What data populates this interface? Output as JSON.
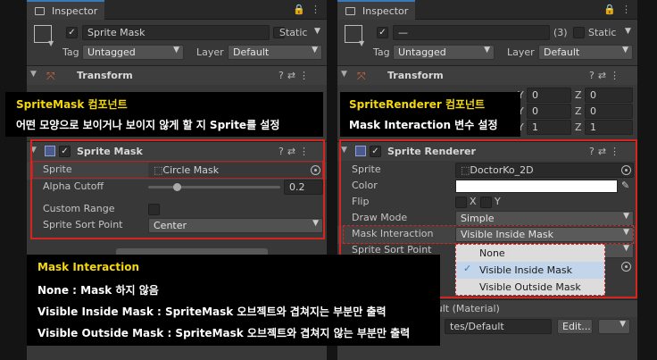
{
  "left": {
    "tab": "Inspector",
    "object_name": "Sprite Mask",
    "static_label": "Static",
    "tag_label": "Tag",
    "tag_value": "Untagged",
    "layer_label": "Layer",
    "layer_value": "Default",
    "transform_title": "Transform",
    "sprite_mask": {
      "title": "Sprite Mask",
      "sprite_label": "Sprite",
      "sprite_value": "Circle Mask",
      "alpha_label": "Alpha Cutoff",
      "alpha_value": "0.2",
      "alpha_fraction": 0.2,
      "custom_range_label": "Custom Range",
      "sort_point_label": "Sprite Sort Point",
      "sort_point_value": "Center"
    }
  },
  "right": {
    "tab": "Inspector",
    "object_name": "—",
    "count": "(3)",
    "static_label": "Static",
    "tag_label": "Tag",
    "tag_value": "Untagged",
    "layer_label": "Layer",
    "layer_value": "Default",
    "transform_title": "Transform",
    "transform_rows": [
      {
        "y_label": "Y",
        "y": "0",
        "z_label": "Z",
        "z": "0"
      },
      {
        "y_label": "Y",
        "y": "0",
        "z_label": "Z",
        "z": "0"
      },
      {
        "y_label": "Y",
        "y": "1",
        "z_label": "Z",
        "z": "1"
      }
    ],
    "sprite_renderer": {
      "title": "Sprite Renderer",
      "sprite_label": "Sprite",
      "sprite_value": "DoctorKo_2D",
      "color_label": "Color",
      "color_value": "#ffffff",
      "flip_label": "Flip",
      "flip_x": "X",
      "flip_y": "Y",
      "draw_mode_label": "Draw Mode",
      "draw_mode_value": "Simple",
      "mask_label": "Mask Interaction",
      "mask_value": "Visible Inside Mask",
      "sort_point_label": "Sprite Sort Point"
    },
    "menu_options": [
      "None",
      "Visible Inside Mask",
      "Visible Outside Mask"
    ],
    "menu_selected": "Visible Inside Mask",
    "material_text": "ault (Material)",
    "material_path": "tes/Default",
    "edit_label": "Edit..."
  },
  "callouts": {
    "spritemask_title": "SpriteMask 컴포넌트",
    "spritemask_desc": "어떤 모양으로 보이거나 보이지 않게 할 지 Sprite를 설정",
    "renderer_title": "SpriteRenderer 컴포넌트",
    "renderer_desc": "Mask Interaction 변수 설정",
    "mask_title": "Mask Interaction",
    "mask_lines": [
      "None : Mask 하지 않음",
      "Visible Inside Mask : SpriteMask 오브젝트와 겹쳐지는 부분만 출력",
      "Visible Outside Mask : SpriteMask 오브젝트와 겹쳐지 않는 부분만 출력"
    ]
  },
  "colors": {
    "highlight": "#d4261f",
    "callout_accent": "#f5d90a",
    "selection": "#3a79bb"
  }
}
